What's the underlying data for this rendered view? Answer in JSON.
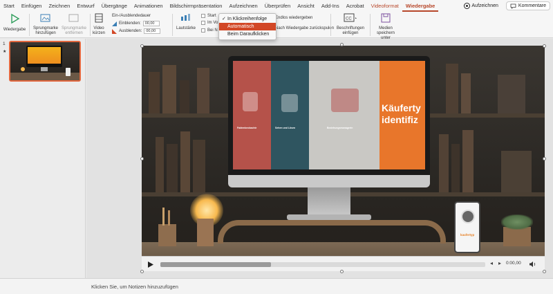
{
  "menu": {
    "items": [
      "Start",
      "Einfügen",
      "Zeichnen",
      "Entwurf",
      "Übergänge",
      "Animationen",
      "Bildschirmpräsentation",
      "Aufzeichnen",
      "Überprüfen",
      "Ansicht",
      "Add-Ins",
      "Acrobat",
      "Videoformat",
      "Wiedergabe"
    ],
    "active": "Wiedergabe",
    "record_label": "Aufzeichnen",
    "comments_label": "Kommentare"
  },
  "ribbon": {
    "play_label": "Wiedergabe",
    "bookmark_add_label": "Sprungmarke hinzufügen",
    "bookmark_remove_label": "Sprungmarke entfernen",
    "trim_label": "Video kürzen",
    "fade_title": "Ein-/Ausblendedauer",
    "fade_in_label": "Einblenden:",
    "fade_in_value": "00,00",
    "fade_out_label": "Ausblenden:",
    "fade_out_value": "00,00",
    "volume_label": "Lautstärke",
    "start_label": "Start",
    "fullscreen_label": "Im Vo",
    "hide_label": "Bei N",
    "loop_label": "Endlos wiedergeben",
    "rewind_label": "Nach Wiedergabe zurückspulen",
    "captions_label": "Beschriftungen einfügen",
    "save_media_label": "Medien speichern unter"
  },
  "start_dropdown": {
    "options": [
      "In Klickreihenfolge",
      "Automatisch",
      "Beim Daraufklicken"
    ],
    "checked": "In Klickreihenfolge",
    "highlighted": "Automatisch"
  },
  "slides_panel": {
    "slide_number": "1",
    "slide_marker": "★"
  },
  "slide": {
    "screen_heading_line1": "Käuferty",
    "screen_heading_line2": "identifiz",
    "panel_captions": [
      "Faktenbeobachtr",
      "Sehen und Lösen",
      "Beziehungsmanagerin"
    ],
    "phone_brand": "kaufertyp"
  },
  "video_controls": {
    "time": "0:00,00",
    "progress": 0.34
  },
  "notes": {
    "placeholder": "Klicken Sie, um Notizen hinzuzufügen"
  },
  "colors": {
    "accent": "#d24726",
    "panel_red": "#b5524a",
    "panel_teal": "#2f5560",
    "panel_orange": "#e8762b"
  }
}
